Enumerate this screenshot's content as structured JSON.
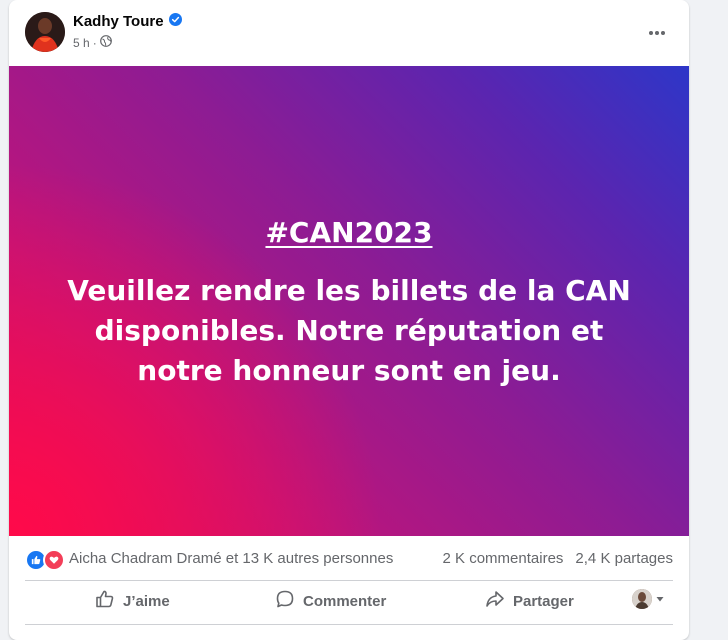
{
  "post": {
    "author": "Kadhy Toure",
    "time": "5 h",
    "hashtag": "#CAN2023",
    "text": "Veuillez rendre les billets de la CAN disponibles. Notre réputation et notre honneur sont en jeu."
  },
  "reactions": {
    "summary": "Aicha Chadram Dramé et 13 K autres personnes",
    "comments": "2 K commentaires",
    "shares": "2,4 K partages"
  },
  "actions": {
    "like": "J’aime",
    "comment": "Commenter",
    "share": "Partager"
  },
  "colors": {
    "like_blue": "#1877f2",
    "love_red": "#f33e58",
    "verified_blue": "#1877f2",
    "gradient": [
      "#ff0a4a",
      "#c0147a",
      "#8c1c94",
      "#5a25b0",
      "#2d36c8"
    ]
  },
  "icons": {
    "verified": "verified-badge-icon",
    "audience": "globe-icon",
    "more": "more-horizontal-icon",
    "like": "thumbs-up-icon",
    "comment": "speech-bubble-icon",
    "share": "share-arrow-icon",
    "dropdown": "caret-down-icon"
  }
}
